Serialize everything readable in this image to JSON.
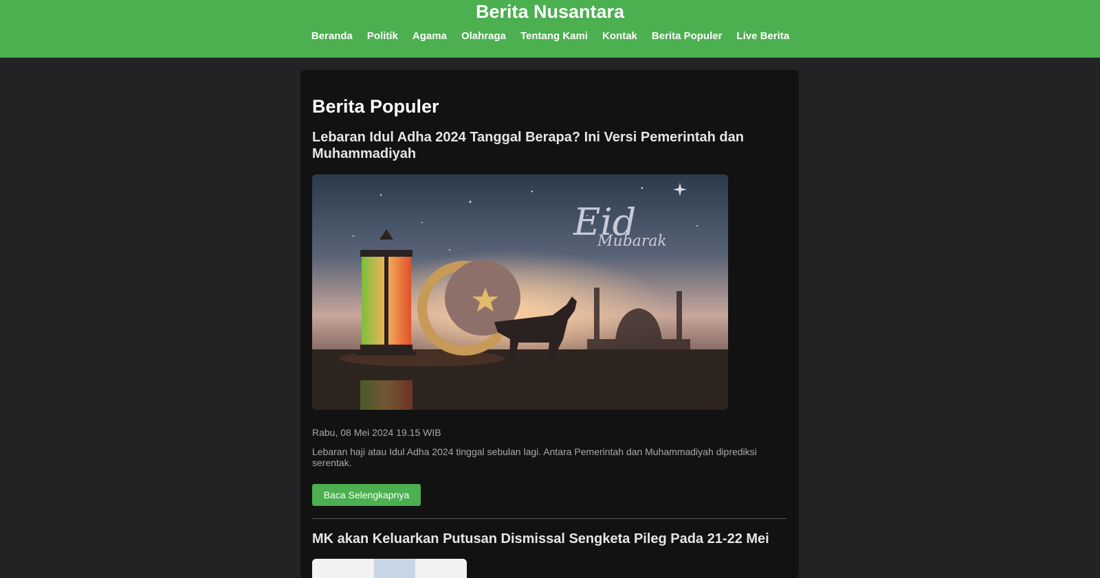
{
  "site": {
    "title": "Berita Nusantara"
  },
  "nav": [
    {
      "label": "Beranda"
    },
    {
      "label": "Politik"
    },
    {
      "label": "Agama"
    },
    {
      "label": "Olahraga"
    },
    {
      "label": "Tentang Kami"
    },
    {
      "label": "Kontak"
    },
    {
      "label": "Berita Populer"
    },
    {
      "label": "Live Berita"
    }
  ],
  "main": {
    "page_title": "Berita Populer",
    "articles": [
      {
        "title": "Lebaran Idul Adha 2024 Tanggal Berapa? Ini Versi Pemerintah dan Muhammadiyah",
        "image_text_1": "Eid",
        "image_text_2": "Mubarak",
        "date": "Rabu, 08 Mei 2024 19.15 WIB",
        "excerpt": "Lebaran haji atau Idul Adha 2024 tinggal sebulan lagi. Antara Pemerintah dan Muhammadiyah diprediksi serentak.",
        "button_label": "Baca Selengkapnya"
      },
      {
        "title": "MK akan Keluarkan Putusan Dismissal Sengketa Pileg Pada 21-22 Mei"
      }
    ]
  },
  "colors": {
    "header_bg": "#4caf50",
    "page_bg": "#232325",
    "panel_bg": "#121212",
    "button_bg": "#4caf50"
  }
}
